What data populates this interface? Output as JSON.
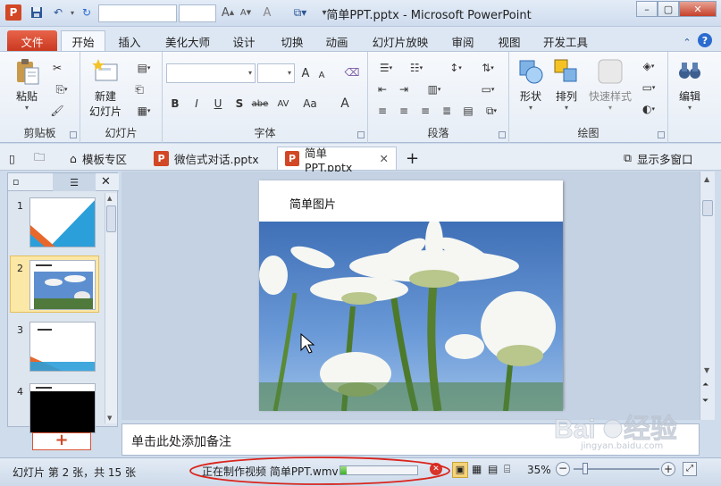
{
  "window": {
    "title": "简单PPT.pptx  -  Microsoft PowerPoint",
    "app_icon": "P"
  },
  "ribbon_tabs": [
    "文件",
    "开始",
    "插入",
    "美化大师",
    "设计",
    "切换",
    "动画",
    "幻灯片放映",
    "审阅",
    "视图",
    "开发工具"
  ],
  "ribbon_groups": {
    "clipboard": {
      "label": "剪贴板",
      "paste": "粘贴"
    },
    "slides": {
      "label": "幻灯片",
      "new_slide_line1": "新建",
      "new_slide_line2": "幻灯片"
    },
    "font": {
      "label": "字体",
      "buttons": [
        "B",
        "I",
        "U",
        "S",
        "abe",
        "AV",
        "Aa",
        "A"
      ],
      "grow": "A",
      "shrink": "A"
    },
    "paragraph": {
      "label": "段落"
    },
    "drawing": {
      "label": "绘图",
      "shape": "形状",
      "arrange": "排列",
      "quick_styles": "快速样式"
    },
    "editing": {
      "label": "编辑"
    }
  },
  "doc_tabs": {
    "templates": "模板专区",
    "tab1": "微信式对话.pptx",
    "tab2": "简单PPT.pptx",
    "show_multi": "显示多窗口"
  },
  "slides_panel": {
    "numbers": [
      "1",
      "2",
      "3",
      "4"
    ],
    "selected": "2"
  },
  "slide": {
    "title": "简单图片"
  },
  "notes_placeholder": "单击此处添加备注",
  "status": {
    "slide_info": "幻灯片 第 2 张，共 15 张",
    "video_progress_text": "正在制作视频 简单PPT.wmv",
    "video_progress": 0.08,
    "zoom": "35%"
  },
  "watermark": {
    "text": "Baidu经验",
    "url": "jingyan.baidu.com"
  }
}
